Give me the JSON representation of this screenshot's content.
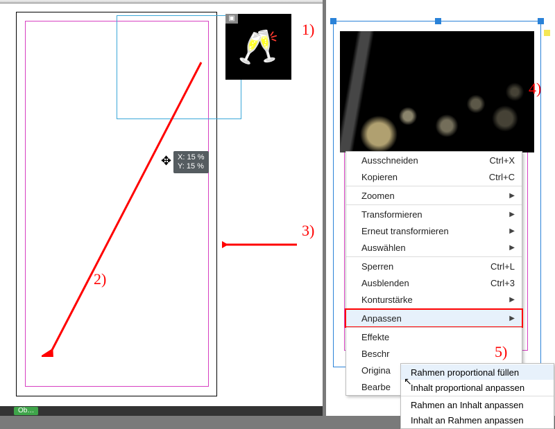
{
  "annotations": {
    "n1": "1)",
    "n2": "2)",
    "n3": "3)",
    "n4": "4)",
    "n5": "5)"
  },
  "coord_tip": "X: 15 %\nY: 15 %",
  "status": "Ob…",
  "ctx": {
    "cut": {
      "label": "Ausschneiden",
      "accel": "Ctrl+X"
    },
    "copy": {
      "label": "Kopieren",
      "accel": "Ctrl+C"
    },
    "zoom": {
      "label": "Zoomen"
    },
    "transform": {
      "label": "Transformieren"
    },
    "retransform": {
      "label": "Erneut transformieren"
    },
    "select": {
      "label": "Auswählen"
    },
    "lock": {
      "label": "Sperren",
      "accel": "Ctrl+L"
    },
    "hide": {
      "label": "Ausblenden",
      "accel": "Ctrl+3"
    },
    "stroke": {
      "label": "Konturstärke"
    },
    "fit": {
      "label": "Anpassen"
    },
    "effects": {
      "label": "Effekte"
    },
    "caption": {
      "label": "Beschr"
    },
    "original": {
      "label": "Origina"
    },
    "edit": {
      "label": "Bearbe"
    }
  },
  "submenu": {
    "fill_prop": "Rahmen proportional füllen",
    "content_prop": "Inhalt proportional anpassen",
    "frame_to_ct": "Rahmen an Inhalt anpassen",
    "ct_to_frame": "Inhalt an Rahmen anpassen"
  }
}
